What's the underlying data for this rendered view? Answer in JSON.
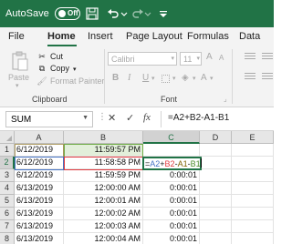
{
  "titlebar": {
    "autosave_label": "AutoSave",
    "autosave_state": "Off"
  },
  "ribbon_tabs": [
    "File",
    "Home",
    "Insert",
    "Page Layout",
    "Formulas",
    "Data"
  ],
  "clipboard": {
    "paste_label": "Paste",
    "cut_label": "Cut",
    "copy_label": "Copy",
    "format_painter_label": "Format Painter",
    "group_label": "Clipboard"
  },
  "font": {
    "font_name": "Calibri",
    "font_size": "11",
    "group_label": "Font"
  },
  "formula_bar": {
    "name_box": "SUM",
    "formula": "=A2+B2-A1-B1",
    "cancel_symbol": "✕",
    "enter_symbol": "✓",
    "fx_symbol": "fx"
  },
  "sheet": {
    "columns": [
      "A",
      "B",
      "C",
      "D",
      "E"
    ],
    "rows": [
      {
        "num": "1",
        "a": "6/12/2019",
        "b": "11:59:57 PM",
        "c": ""
      },
      {
        "num": "2",
        "a": "6/12/2019",
        "b": "11:58:58 PM",
        "c": "=A2+B2-A1-B1"
      },
      {
        "num": "3",
        "a": "6/12/2019",
        "b": "11:59:59 PM",
        "c": "0:00:01"
      },
      {
        "num": "4",
        "a": "6/13/2019",
        "b": "12:00:00 AM",
        "c": "0:00:01"
      },
      {
        "num": "5",
        "a": "6/13/2019",
        "b": "12:00:01 AM",
        "c": "0:00:01"
      },
      {
        "num": "6",
        "a": "6/13/2019",
        "b": "12:00:02 AM",
        "c": "0:00:01"
      },
      {
        "num": "7",
        "a": "6/13/2019",
        "b": "12:00:03 AM",
        "c": "0:00:01"
      },
      {
        "num": "8",
        "a": "6/13/2019",
        "b": "12:00:04 AM",
        "c": "0:00:01"
      }
    ]
  },
  "colors": {
    "excel_green": "#217346",
    "ref_a2": "#4472c4",
    "ref_b2": "#e0393e",
    "ref_a1": "#7f6000",
    "ref_b1": "#70ad47"
  }
}
